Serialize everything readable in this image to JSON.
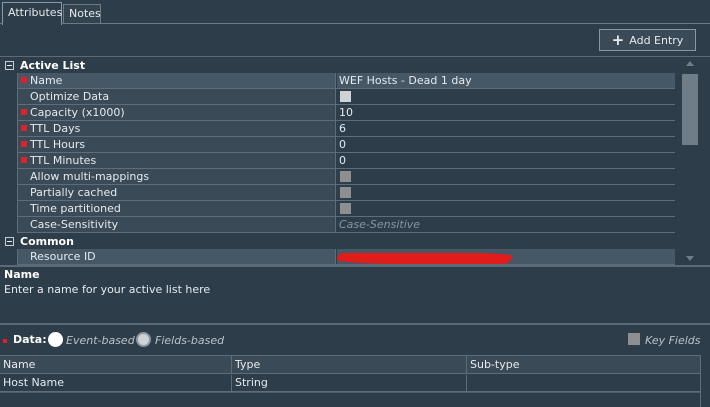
{
  "tabs": [
    {
      "label": "Attributes",
      "active": true
    },
    {
      "label": "Notes",
      "active": false
    }
  ],
  "toolbar": {
    "add_entry_label": "Add Entry"
  },
  "property_groups": [
    {
      "label": "Active List",
      "rows": [
        {
          "name": "Name",
          "required": true,
          "value": "WEF Hosts - Dead 1 day",
          "type": "text",
          "selected": true
        },
        {
          "name": "Optimize Data",
          "required": false,
          "type": "checkbox",
          "checked": false,
          "enabled": true
        },
        {
          "name": "Capacity (x1000)",
          "required": true,
          "value": "10",
          "type": "text"
        },
        {
          "name": "TTL Days",
          "required": true,
          "value": "6",
          "type": "text"
        },
        {
          "name": "TTL Hours",
          "required": true,
          "value": "0",
          "type": "text"
        },
        {
          "name": "TTL Minutes",
          "required": true,
          "value": "0",
          "type": "text"
        },
        {
          "name": "Allow multi-mappings",
          "required": false,
          "type": "checkbox",
          "checked": false,
          "enabled": false
        },
        {
          "name": "Partially cached",
          "required": false,
          "type": "checkbox",
          "checked": false,
          "enabled": false
        },
        {
          "name": "Time partitioned",
          "required": false,
          "type": "checkbox",
          "checked": false,
          "enabled": false
        },
        {
          "name": "Case-Sensitivity",
          "required": false,
          "value": "Case-Sensitive",
          "type": "placeholder"
        }
      ]
    },
    {
      "label": "Common",
      "rows": [
        {
          "name": "Resource ID",
          "required": false,
          "type": "redacted",
          "selected": true
        }
      ]
    }
  ],
  "description": {
    "title": "Name",
    "text": "Enter a name for your active list here"
  },
  "data_section": {
    "label": "Data:",
    "options": [
      {
        "label": "Event-based",
        "selected": true
      },
      {
        "label": "Fields-based",
        "selected": false
      }
    ],
    "key_fields_label": "Key Fields"
  },
  "fields_table": {
    "columns": [
      "Name",
      "Type",
      "Sub-type"
    ],
    "rows": [
      [
        "Host Name",
        "String",
        ""
      ]
    ]
  },
  "colors": {
    "background": "#2d3d49",
    "required_marker": "#e3202a",
    "redaction": "#e21b1b"
  }
}
